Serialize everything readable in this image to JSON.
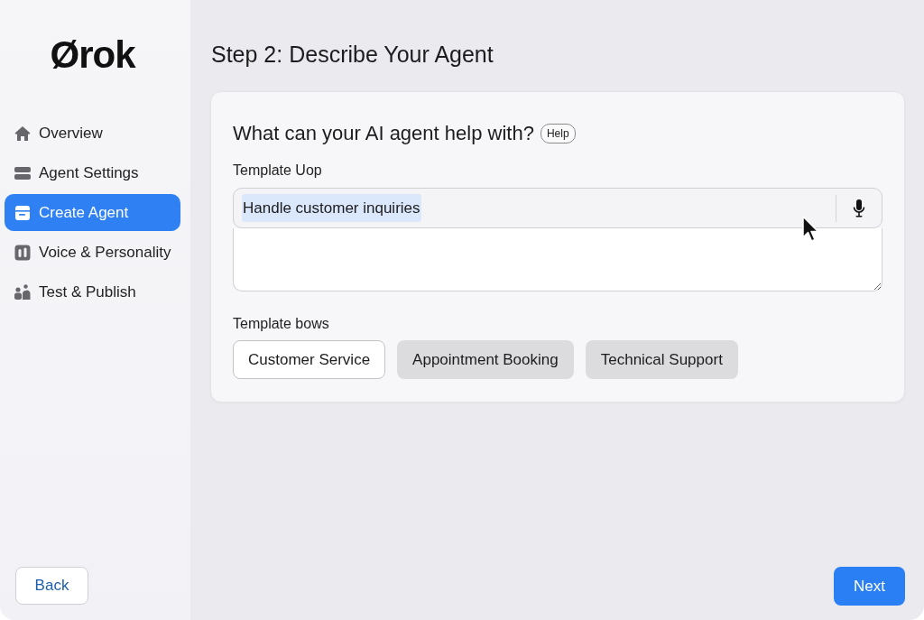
{
  "sidebar": {
    "logo": "Ørok",
    "items": [
      {
        "label": "Overview",
        "selected": false
      },
      {
        "label": "Agent Settings",
        "selected": false
      },
      {
        "label": "Create Agent",
        "selected": true
      },
      {
        "label": "Voice & Personality",
        "selected": false
      },
      {
        "label": "Test & Publish",
        "selected": false
      }
    ],
    "back_button": "Back"
  },
  "page": {
    "title": "Step 2: Describe Your Agent"
  },
  "card": {
    "question": "What can your AI agent help with?",
    "help": "Help",
    "input_label": "Template Uop",
    "input": {
      "value": "Handle customer inquiries",
      "highlighted": true
    },
    "templates_label": "Template bows",
    "templates": [
      {
        "label": "Customer Service",
        "selected": true
      },
      {
        "label": "Appointment Booking",
        "selected": false
      },
      {
        "label": "Technical Support",
        "selected": false
      }
    ]
  },
  "footer": {
    "next_button": "Next"
  }
}
